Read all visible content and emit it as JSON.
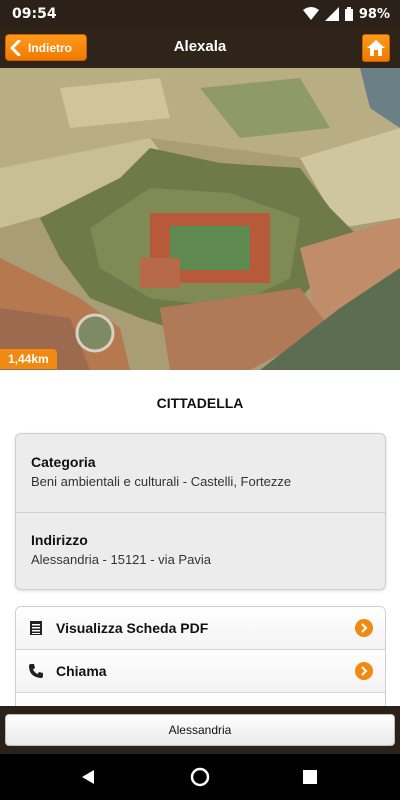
{
  "status_bar": {
    "time": "09:54",
    "battery": "98%"
  },
  "header": {
    "back_label": "Indietro",
    "title": "Alexala"
  },
  "hero": {
    "distance": "1,44km"
  },
  "place": {
    "title": "CITTADELLA"
  },
  "info": {
    "category_label": "Categoria",
    "category_value": "Beni ambientali e culturali - Castelli, Fortezze",
    "address_label": "Indirizzo",
    "address_value": "Alessandria - 15121 - via Pavia"
  },
  "actions": [
    {
      "label": "Visualizza Scheda PDF",
      "icon": "document-icon"
    },
    {
      "label": "Chiama",
      "icon": "phone-icon"
    }
  ],
  "footer": {
    "label": "Alessandria"
  },
  "colors": {
    "accent": "#f08a12",
    "header_bg": "#2f2419"
  }
}
